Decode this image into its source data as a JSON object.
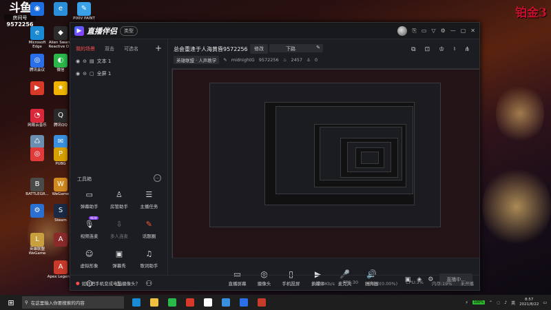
{
  "desktop": {
    "logo": "斗鱼",
    "logo_sub": "房间号",
    "room_number": "9572256",
    "watermark": "铂金3",
    "icons": [
      {
        "label": "",
        "color": "#1d6fe0",
        "glyph": "◉"
      },
      {
        "label": "",
        "color": "#2a8fd8",
        "glyph": "e"
      },
      {
        "label": "PIXIV PAINT",
        "color": "#3aa0e8",
        "glyph": "✎"
      },
      {
        "label": "Microsoft Edge",
        "color": "#1a8ad4",
        "glyph": "e"
      },
      {
        "label": "Alien Swarm Reactive D...",
        "color": "#2c2c2c",
        "glyph": "◆"
      },
      {
        "label": "腾讯会议",
        "color": "#2b6fe8",
        "glyph": "◎"
      },
      {
        "label": "微信",
        "color": "#2bb84a",
        "glyph": "◐"
      },
      {
        "label": "",
        "color": "#d83a2a",
        "glyph": "▶"
      },
      {
        "label": "",
        "color": "#f0b400",
        "glyph": "★"
      },
      {
        "label": "网易云音乐",
        "color": "#d8283a",
        "glyph": "◔"
      },
      {
        "label": "腾讯QQ",
        "color": "#2a2a2a",
        "glyph": "Q"
      },
      {
        "label": "回收站",
        "color": "#6a8fb0",
        "glyph": "♺"
      },
      {
        "label": "",
        "color": "#3a90e0",
        "glyph": "✉"
      },
      {
        "label": "",
        "color": "#e03a3a",
        "glyph": "◎"
      },
      {
        "label": "PUBG",
        "color": "#d8a000",
        "glyph": "P"
      },
      {
        "label": "BATTLEGR...",
        "color": "#4a4a4a",
        "glyph": "B"
      },
      {
        "label": "WeGame",
        "color": "#d08a20",
        "glyph": "W"
      },
      {
        "label": "",
        "color": "#2a70d0",
        "glyph": "⚙"
      },
      {
        "label": "Steam",
        "color": "#1a2a44",
        "glyph": "S"
      },
      {
        "label": "英雄联盟 WeGame",
        "color": "#c8a040",
        "glyph": "L"
      },
      {
        "label": "",
        "color": "#8a2a2a",
        "glyph": "A"
      },
      {
        "label": "Apex Legends",
        "color": "#c83a2a",
        "glyph": "A"
      }
    ]
  },
  "app": {
    "name": "直播伴侣",
    "type_button": "类型",
    "titlebar_icons": [
      "avatar",
      "gift-icon",
      "message-icon",
      "shirt-icon",
      "settings-icon",
      "minimize-icon",
      "maximize-icon",
      "close-icon"
    ]
  },
  "sidebar": {
    "tabs": [
      "我的场景",
      "双击",
      "可选名"
    ],
    "add": "+",
    "scenes": [
      "文本 1",
      "全屏 1"
    ],
    "toolbox_title": "工具箱",
    "toolbox_more": "···",
    "tools": [
      {
        "label": "弹幕助手",
        "glyph": "▭",
        "style": ""
      },
      {
        "label": "房管助手",
        "glyph": "♙",
        "style": ""
      },
      {
        "label": "主播任务",
        "glyph": "☰",
        "style": ""
      },
      {
        "label": "视频连麦",
        "glyph": "🎙",
        "style": "",
        "badge": "NEW"
      },
      {
        "label": "多人连麦",
        "glyph": "⇩",
        "style": "muted"
      },
      {
        "label": "话题圈",
        "glyph": "✎",
        "style": "red"
      },
      {
        "label": "虚拟形象",
        "glyph": "☺",
        "style": ""
      },
      {
        "label": "弹幕秀",
        "glyph": "▣",
        "style": ""
      },
      {
        "label": "歌词助手",
        "glyph": "♫",
        "style": ""
      },
      {
        "label": "",
        "glyph": "⬡",
        "style": ""
      },
      {
        "label": "",
        "glyph": "♨",
        "style": ""
      },
      {
        "label": "",
        "glyph": "⚇",
        "style": ""
      }
    ]
  },
  "main": {
    "room_title": "总会重逢于人海黄昏9572256",
    "edit_label": "修改",
    "category": "下路",
    "meta_tag": "英雄联盟 · 人声教学",
    "streamer": "midnightG",
    "room_id": "9572256",
    "heat": "2457",
    "viewers": "0",
    "action_icons": [
      "share-screen-icon",
      "lock-icon",
      "trophy-icon",
      "bell-icon",
      "share-icon"
    ]
  },
  "bottom": {
    "items": [
      {
        "label": "直播屏幕",
        "glyph": "▭"
      },
      {
        "label": "摄像头",
        "glyph": "◎"
      },
      {
        "label": "手机投屏",
        "glyph": "▯"
      },
      {
        "label": "多媒体",
        "glyph": "▶"
      },
      {
        "label": "麦克风",
        "glyph": "🎤"
      },
      {
        "label": "扬声器",
        "glyph": "🔊"
      }
    ],
    "live_button": "直播中..."
  },
  "status": {
    "tip": "如何把手机变成电脑摄像头？",
    "bitrate": "码率:0Kb/s",
    "fps": "FPS:30",
    "drop": "丢帧:0(0.00%)",
    "cpu": "CPU:3%",
    "memory": "内存:19%",
    "live_state": "未开播"
  },
  "taskbar": {
    "start": "⊞",
    "search_placeholder": "在这里输入你要搜索的内容",
    "battery": "100%",
    "time": "8:57",
    "date": "2021/8/22",
    "app_colors": [
      "#1a8ad4",
      "#f0c040",
      "#2bb84a",
      "#d83a2a",
      "#ffffff",
      "#3a90e0",
      "#2b6fe8",
      "#c83a2a"
    ]
  },
  "colors": {
    "accent": "#ff4d4f",
    "window_bg": "#1c1d22"
  }
}
